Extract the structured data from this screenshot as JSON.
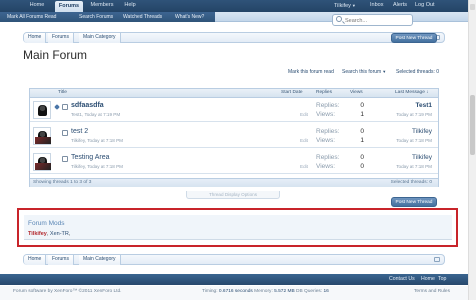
{
  "nav": {
    "tabs": [
      "Home",
      "Forums",
      "Members",
      "Help"
    ],
    "account": {
      "user": "Tilkifey",
      "inbox": "Inbox",
      "alerts": "Alerts",
      "logout": "Log Out"
    },
    "sublinks": [
      "Mark All Forums Read",
      "Search Forums",
      "Watched Threads",
      "What's New?"
    ],
    "search_placeholder": "Search..."
  },
  "breadcrumb": [
    "Home",
    "Forums",
    "Main Category"
  ],
  "post_button": "Post New Thread",
  "page_title": "Main Forum",
  "actions": {
    "mark_read": "Mark this forum read",
    "search": "Search this forum",
    "selected": "Selected threads: 0"
  },
  "table": {
    "headers": {
      "title": "Title",
      "start_date": "Start Date",
      "replies": "Replies",
      "views": "Views",
      "last_message": "Last Message ↓"
    },
    "replies_label": "Replies:",
    "views_label": "Views:",
    "edit_label": "Edit",
    "rows": [
      {
        "title": "sdfaasdfa",
        "meta": "Test1, Today at 7:19 PM",
        "replies": "0",
        "views": "1",
        "last_user": "Test1",
        "last_time": "Today at 7:19 PM",
        "unread": true
      },
      {
        "title": "test 2",
        "meta": "Tilkifey, Today at 7:18 PM",
        "replies": "0",
        "views": "1",
        "last_user": "Tilkifey",
        "last_time": "Today at 7:18 PM",
        "unread": false
      },
      {
        "title": "Testing Area",
        "meta": "Tilkifey, Today at 7:18 PM",
        "replies": "0",
        "views": "0",
        "last_user": "Tilkifey",
        "last_time": "Today at 7:18 PM",
        "unread": false
      }
    ],
    "footer_showing": "Showing threads 1 to 3 of 3",
    "footer_selected": "Selected threads: 0"
  },
  "thread_display": "Thread Display Options",
  "mods": {
    "title": "Forum Mods",
    "mod1": "Tilkifey",
    "separator": ", ",
    "mod2": "Xen-TR",
    "suffix": ","
  },
  "footer": {
    "links": [
      "Contact Us",
      "Home",
      "Top"
    ],
    "copyright": "Forum software by XenForo™ ©2011 XenForo Ltd.",
    "timing_label": "Timing:",
    "timing": "0.6716 seconds",
    "memory_label": "Memory:",
    "memory": "5.572 MB",
    "db_label": "DB Queries:",
    "db": "16",
    "terms": "Terms and Rules"
  },
  "colors": {
    "nav": "#2f5379",
    "accent": "#2b4d72",
    "mods_border": "#c8242a"
  }
}
